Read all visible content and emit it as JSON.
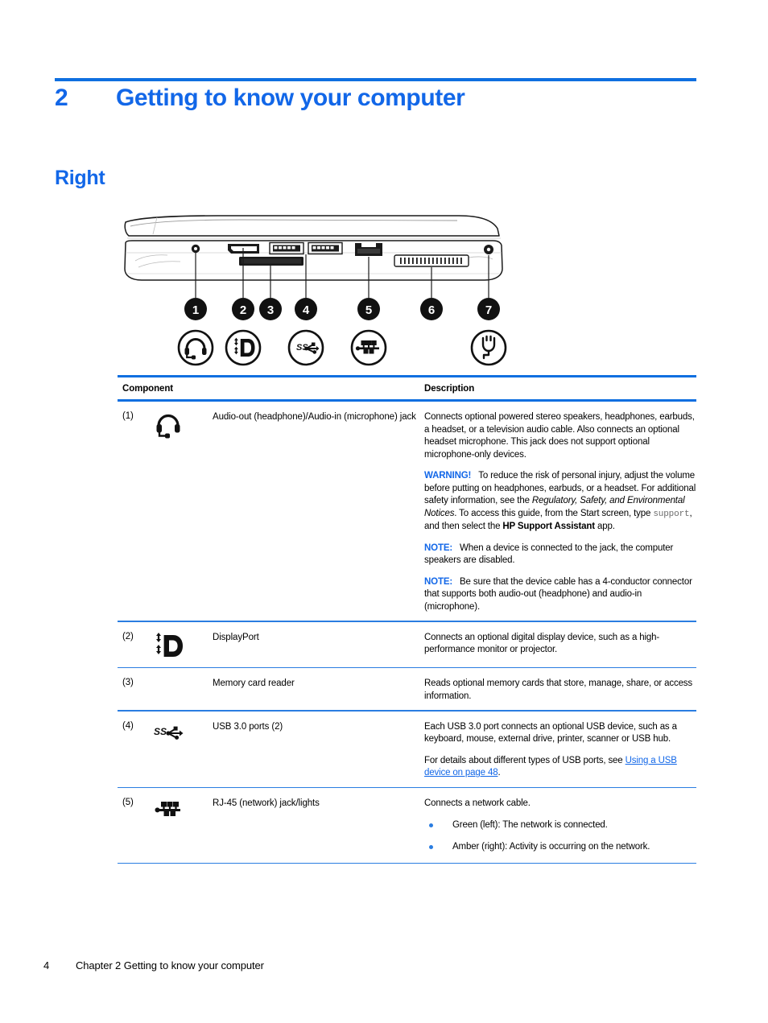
{
  "chapter": {
    "number": "2",
    "title": "Getting to know your computer"
  },
  "section": {
    "title": "Right"
  },
  "figure": {
    "name": "right-side-computer-illustration",
    "callouts": [
      "1",
      "2",
      "3",
      "4",
      "5",
      "6",
      "7"
    ],
    "callout_icons": [
      "headset-icon",
      "displayport-icon",
      "",
      "usb-superspeed-icon",
      "rj45-network-icon",
      "",
      "power-connector-icon"
    ]
  },
  "table": {
    "headers": {
      "component": "Component",
      "description": "Description"
    },
    "rows": [
      {
        "num": "(1)",
        "icon": "headset-icon",
        "name": "Audio-out (headphone)/Audio-in (microphone) jack",
        "desc_1": "Connects optional powered stereo speakers, headphones, earbuds, a headset, or a television audio cable. Also connects an optional headset microphone. This jack does not support optional microphone-only devices.",
        "warning_label": "WARNING!",
        "warning_a": "To reduce the risk of personal injury, adjust the volume before putting on headphones, earbuds, or a headset. For additional safety information, see the ",
        "warning_italic": "Regulatory, Safety, and Environmental Notices",
        "warning_b": ". To access this guide, from the Start screen, type ",
        "warning_mono": "support",
        "warning_c": ", and then select the ",
        "warning_bold": "HP Support Assistant",
        "warning_d": " app.",
        "note1_label": "NOTE:",
        "note1_text": "When a device is connected to the jack, the computer speakers are disabled.",
        "note2_label": "NOTE:",
        "note2_text": "Be sure that the device cable has a 4-conductor connector that supports both audio-out (headphone) and audio-in (microphone)."
      },
      {
        "num": "(2)",
        "icon": "displayport-icon",
        "name": "DisplayPort",
        "desc_1": "Connects an optional digital display device, such as a high-performance monitor or projector."
      },
      {
        "num": "(3)",
        "icon": "",
        "name": "Memory card reader",
        "desc_1": "Reads optional memory cards that store, manage, share, or access information."
      },
      {
        "num": "(4)",
        "icon": "usb-superspeed-icon",
        "name": "USB 3.0 ports (2)",
        "desc_1": "Each USB 3.0 port connects an optional USB device, such as a keyboard, mouse, external drive, printer, scanner or USB hub.",
        "desc_2_pre": "For details about different types of USB ports, see ",
        "desc_2_link": "Using a USB device on page 48",
        "desc_2_post": "."
      },
      {
        "num": "(5)",
        "icon": "rj45-network-icon",
        "name": "RJ-45 (network) jack/lights",
        "desc_1": "Connects a network cable.",
        "bullets": [
          "Green (left): The network is connected.",
          "Amber (right): Activity is occurring on the network."
        ]
      }
    ]
  },
  "footer": {
    "page_number": "4",
    "chapter_text": "Chapter 2   Getting to know your computer"
  },
  "colors": {
    "accent_blue": "#1267e8",
    "rule_blue": "#0f6fe0",
    "thin_rule_blue": "#2a7de1"
  }
}
